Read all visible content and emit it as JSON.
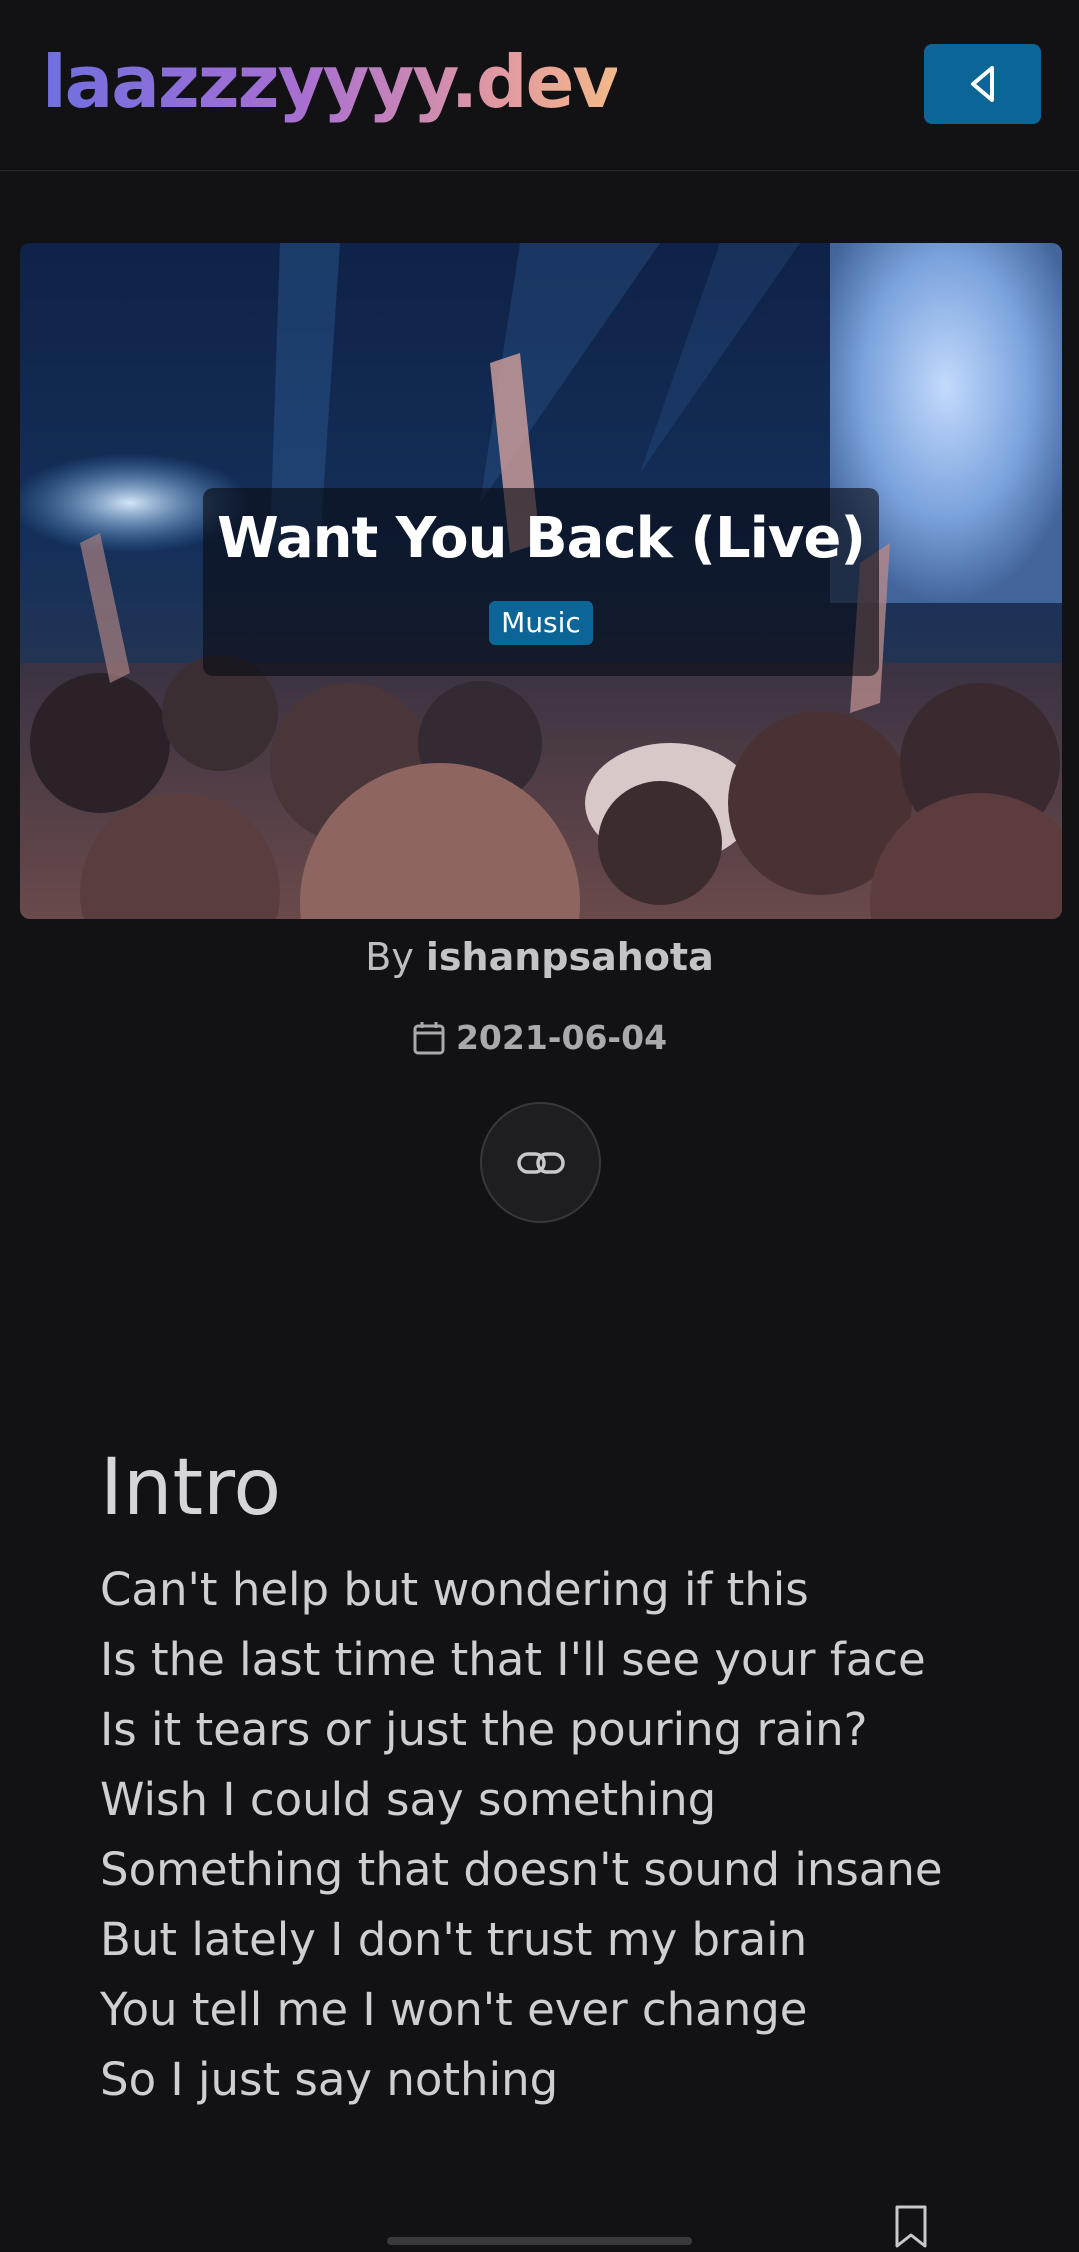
{
  "site": {
    "logo_text": "laazzzyyyy.dev"
  },
  "header": {
    "back_button_icon": "chevron-left-icon"
  },
  "post": {
    "title": "Want You Back (Live)",
    "category": "Music",
    "byline_prefix": "By",
    "author": "ishanpsahota",
    "date": "2021-06-04",
    "share_icon": "link-icon",
    "hero_image": "concert-crowd-photo"
  },
  "content": {
    "heading": "Intro",
    "lines": [
      "Can't help but wondering if this",
      "Is the last time that I'll see your face",
      "Is it tears or just the pouring rain?",
      "Wish I could say something",
      "Something that doesn't sound insane",
      "But lately I don't trust my brain",
      "You tell me I won't ever change",
      "So I just say nothing"
    ]
  },
  "footer": {
    "bookmark_icon": "bookmark-icon"
  },
  "colors": {
    "background": "#121214",
    "accent": "#0b6596",
    "logo_gradient": [
      "#6f6fe0",
      "#a86fd2",
      "#e29aa0",
      "#f2b98a"
    ]
  }
}
